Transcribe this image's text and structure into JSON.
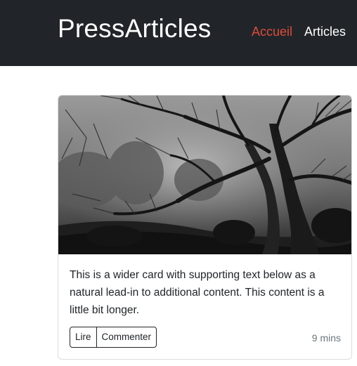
{
  "navbar": {
    "brand": "PressArticles",
    "links": [
      {
        "label": "Accueil",
        "active": true,
        "color": "#dc4c3a"
      },
      {
        "label": "Articles",
        "active": false,
        "color": "#ffffff"
      }
    ],
    "background": "#212529"
  },
  "card": {
    "image": "black-and-white-forest-trees",
    "text": "This is a wider card with supporting text below as a natural lead-in to additional content. This content is a little bit longer.",
    "buttons": {
      "read_label": "Lire",
      "comment_label": "Commenter"
    },
    "time": "9 mins"
  }
}
